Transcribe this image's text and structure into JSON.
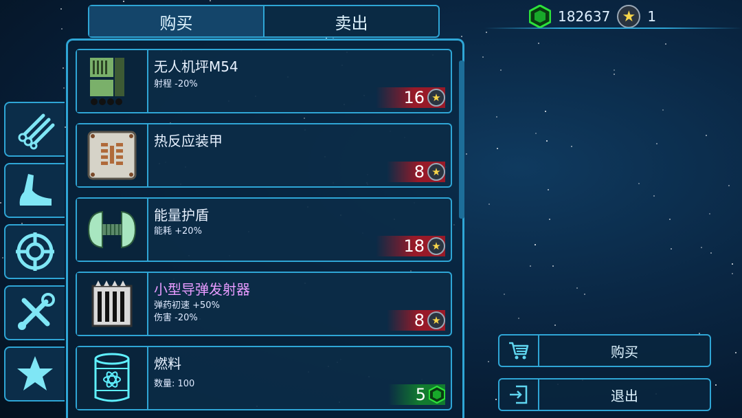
{
  "tabs": {
    "buy": "购买",
    "sell": "卖出",
    "active": "buy"
  },
  "currency": {
    "gems": "182637",
    "stars": "1"
  },
  "categories": [
    {
      "icon": "pipes-icon"
    },
    {
      "icon": "hull-icon"
    },
    {
      "icon": "target-icon"
    },
    {
      "icon": "tools-icon"
    },
    {
      "icon": "star-icon"
    }
  ],
  "items": [
    {
      "name": "无人机坪M54",
      "stats": [
        "射程 -20%"
      ],
      "price": "16",
      "currency": "star",
      "icon": "drone-pad-icon"
    },
    {
      "name": "热反应装甲",
      "stats": [],
      "price": "8",
      "currency": "star",
      "icon": "armor-plate-icon"
    },
    {
      "name": "能量护盾",
      "stats": [
        "能耗 +20%"
      ],
      "price": "18",
      "currency": "star",
      "icon": "shield-generator-icon"
    },
    {
      "name": "小型导弹发射器",
      "stats": [
        "弹药初速 +50%",
        "伤害 -20%"
      ],
      "price": "8",
      "currency": "star",
      "icon": "missile-launcher-icon"
    },
    {
      "name": "燃料",
      "stats": [
        "数量: 100"
      ],
      "price": "5",
      "currency": "gem",
      "icon": "fuel-barrel-icon"
    }
  ],
  "actions": {
    "buy": "购买",
    "exit": "退出"
  },
  "colors": {
    "accent": "#2fa6d6",
    "price_red": "#c8141e",
    "price_green": "#149628",
    "highlight_name": "#e79bff"
  }
}
